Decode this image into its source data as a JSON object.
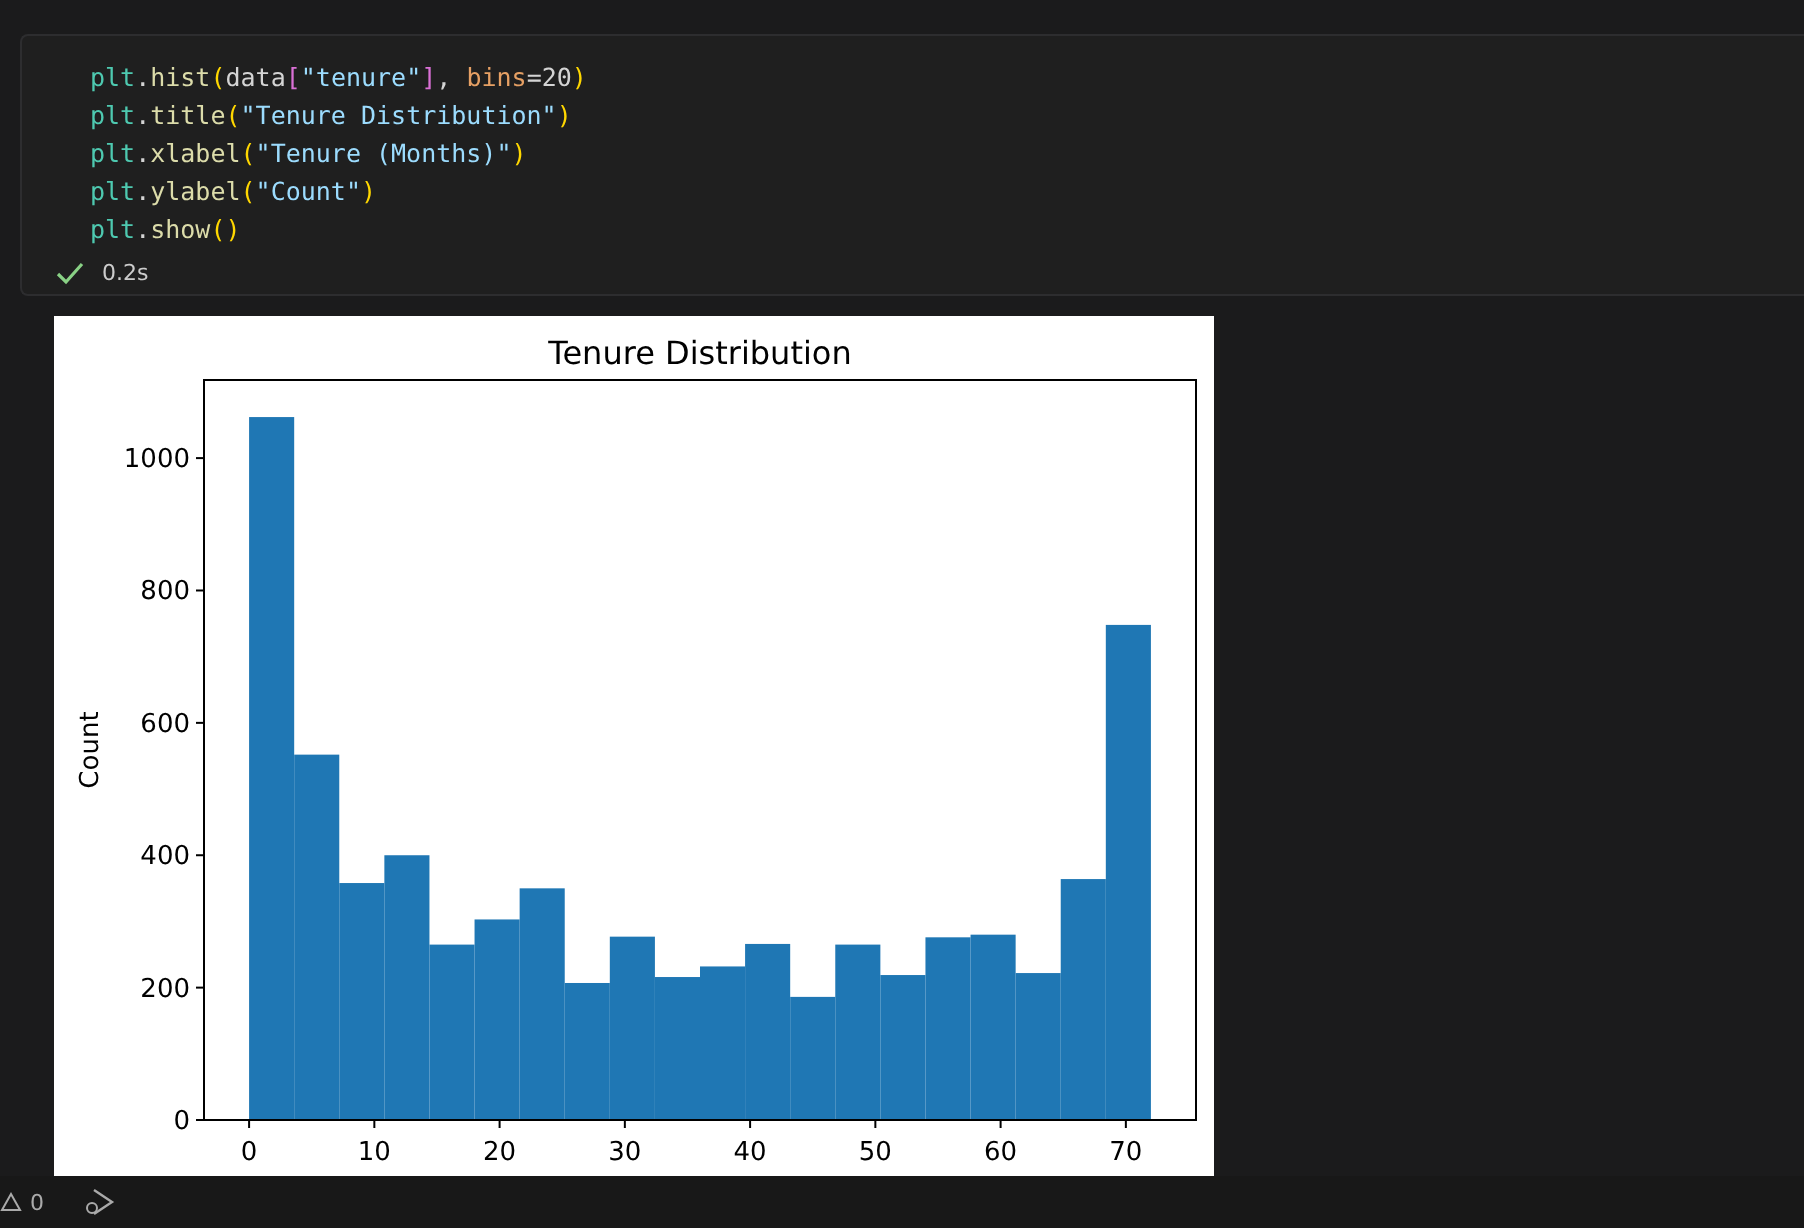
{
  "code_cell": {
    "lines": [
      {
        "tokens": [
          {
            "text": "plt",
            "kind": "module"
          },
          {
            "text": ".",
            "kind": "plain"
          },
          {
            "text": "hist",
            "kind": "func"
          },
          {
            "text": "(",
            "kind": "paren"
          },
          {
            "text": "data",
            "kind": "plain"
          },
          {
            "text": "[",
            "kind": "bracket"
          },
          {
            "text": "\"tenure\"",
            "kind": "string"
          },
          {
            "text": "]",
            "kind": "bracket"
          },
          {
            "text": ", ",
            "kind": "plain"
          },
          {
            "text": "bins",
            "kind": "param"
          },
          {
            "text": "=20",
            "kind": "plain"
          },
          {
            "text": ")",
            "kind": "paren"
          }
        ]
      },
      {
        "tokens": [
          {
            "text": "plt",
            "kind": "module"
          },
          {
            "text": ".",
            "kind": "plain"
          },
          {
            "text": "title",
            "kind": "func"
          },
          {
            "text": "(",
            "kind": "paren"
          },
          {
            "text": "\"Tenure Distribution\"",
            "kind": "string"
          },
          {
            "text": ")",
            "kind": "paren"
          }
        ]
      },
      {
        "tokens": [
          {
            "text": "plt",
            "kind": "module"
          },
          {
            "text": ".",
            "kind": "plain"
          },
          {
            "text": "xlabel",
            "kind": "func"
          },
          {
            "text": "(",
            "kind": "paren"
          },
          {
            "text": "\"Tenure (Months)\"",
            "kind": "string"
          },
          {
            "text": ")",
            "kind": "paren"
          }
        ]
      },
      {
        "tokens": [
          {
            "text": "plt",
            "kind": "module"
          },
          {
            "text": ".",
            "kind": "plain"
          },
          {
            "text": "ylabel",
            "kind": "func"
          },
          {
            "text": "(",
            "kind": "paren"
          },
          {
            "text": "\"Count\"",
            "kind": "string"
          },
          {
            "text": ")",
            "kind": "paren"
          }
        ]
      },
      {
        "tokens": [
          {
            "text": "plt",
            "kind": "module"
          },
          {
            "text": ".",
            "kind": "plain"
          },
          {
            "text": "show",
            "kind": "func"
          },
          {
            "text": "()",
            "kind": "paren"
          }
        ]
      }
    ],
    "execution": {
      "succeeded": true,
      "time": "0.2s"
    }
  },
  "output": {
    "chart_data": {
      "type": "bar",
      "title": "Tenure Distribution",
      "ylabel": "Count",
      "x": [
        1.8,
        5.4,
        9,
        12.6,
        16.2,
        19.8,
        23.4,
        27,
        30.6,
        34.2,
        37.8,
        41.4,
        45,
        48.6,
        52.2,
        55.8,
        59.4,
        63,
        66.6,
        70.2
      ],
      "series": [
        {
          "color": "#1f77b4",
          "values": [
            1062,
            552,
            358,
            400,
            265,
            303,
            350,
            207,
            277,
            216,
            232,
            266,
            186,
            265,
            219,
            276,
            280,
            222,
            364,
            748
          ]
        }
      ],
      "xlim": [
        -3.6,
        75.6
      ],
      "ylim": [
        0,
        1118
      ],
      "xticks": [
        0,
        10,
        20,
        30,
        40,
        50,
        60,
        70
      ],
      "yticks": [
        0,
        200,
        400,
        600,
        800,
        1000
      ]
    }
  },
  "status_bar": {
    "warnings": "0"
  }
}
